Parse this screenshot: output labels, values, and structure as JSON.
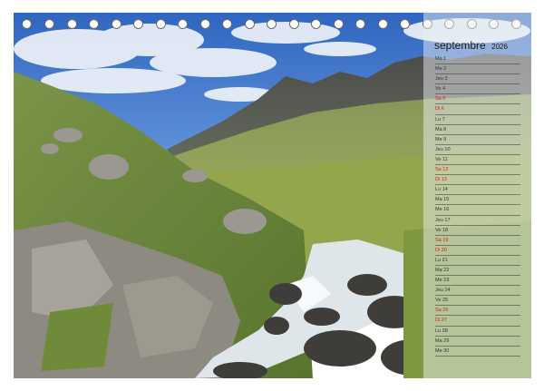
{
  "calendar": {
    "month": "septembre",
    "year": "2026",
    "days": [
      {
        "label": "Ma 1",
        "weekend": false
      },
      {
        "label": "Me 2",
        "weekend": false
      },
      {
        "label": "Jeu 3",
        "weekend": false
      },
      {
        "label": "Ve 4",
        "weekend": false
      },
      {
        "label": "Sa 5",
        "weekend": true
      },
      {
        "label": "Di 6",
        "weekend": true
      },
      {
        "label": "Lu 7",
        "weekend": false
      },
      {
        "label": "Ma 8",
        "weekend": false
      },
      {
        "label": "Me 9",
        "weekend": false
      },
      {
        "label": "Jeu 10",
        "weekend": false
      },
      {
        "label": "Ve 11",
        "weekend": false
      },
      {
        "label": "Sa 12",
        "weekend": true
      },
      {
        "label": "Di 13",
        "weekend": true
      },
      {
        "label": "Lu 14",
        "weekend": false
      },
      {
        "label": "Ma 15",
        "weekend": false
      },
      {
        "label": "Me 16",
        "weekend": false
      },
      {
        "label": "Jeu 17",
        "weekend": false
      },
      {
        "label": "Ve 18",
        "weekend": false
      },
      {
        "label": "Sa 19",
        "weekend": true
      },
      {
        "label": "Di 20",
        "weekend": true
      },
      {
        "label": "Lu 21",
        "weekend": false
      },
      {
        "label": "Ma 22",
        "weekend": false
      },
      {
        "label": "Me 23",
        "weekend": false
      },
      {
        "label": "Jeu 24",
        "weekend": false
      },
      {
        "label": "Ve 25",
        "weekend": false
      },
      {
        "label": "Sa 26",
        "weekend": true
      },
      {
        "label": "Di 27",
        "weekend": true
      },
      {
        "label": "Lu 28",
        "weekend": false
      },
      {
        "label": "Ma 29",
        "weekend": false
      },
      {
        "label": "Me 30",
        "weekend": false
      }
    ]
  },
  "colors": {
    "weekend": "#d21b1b",
    "weekday": "#333333",
    "sky": "#3d74c4",
    "grass": "#8aa34a"
  }
}
